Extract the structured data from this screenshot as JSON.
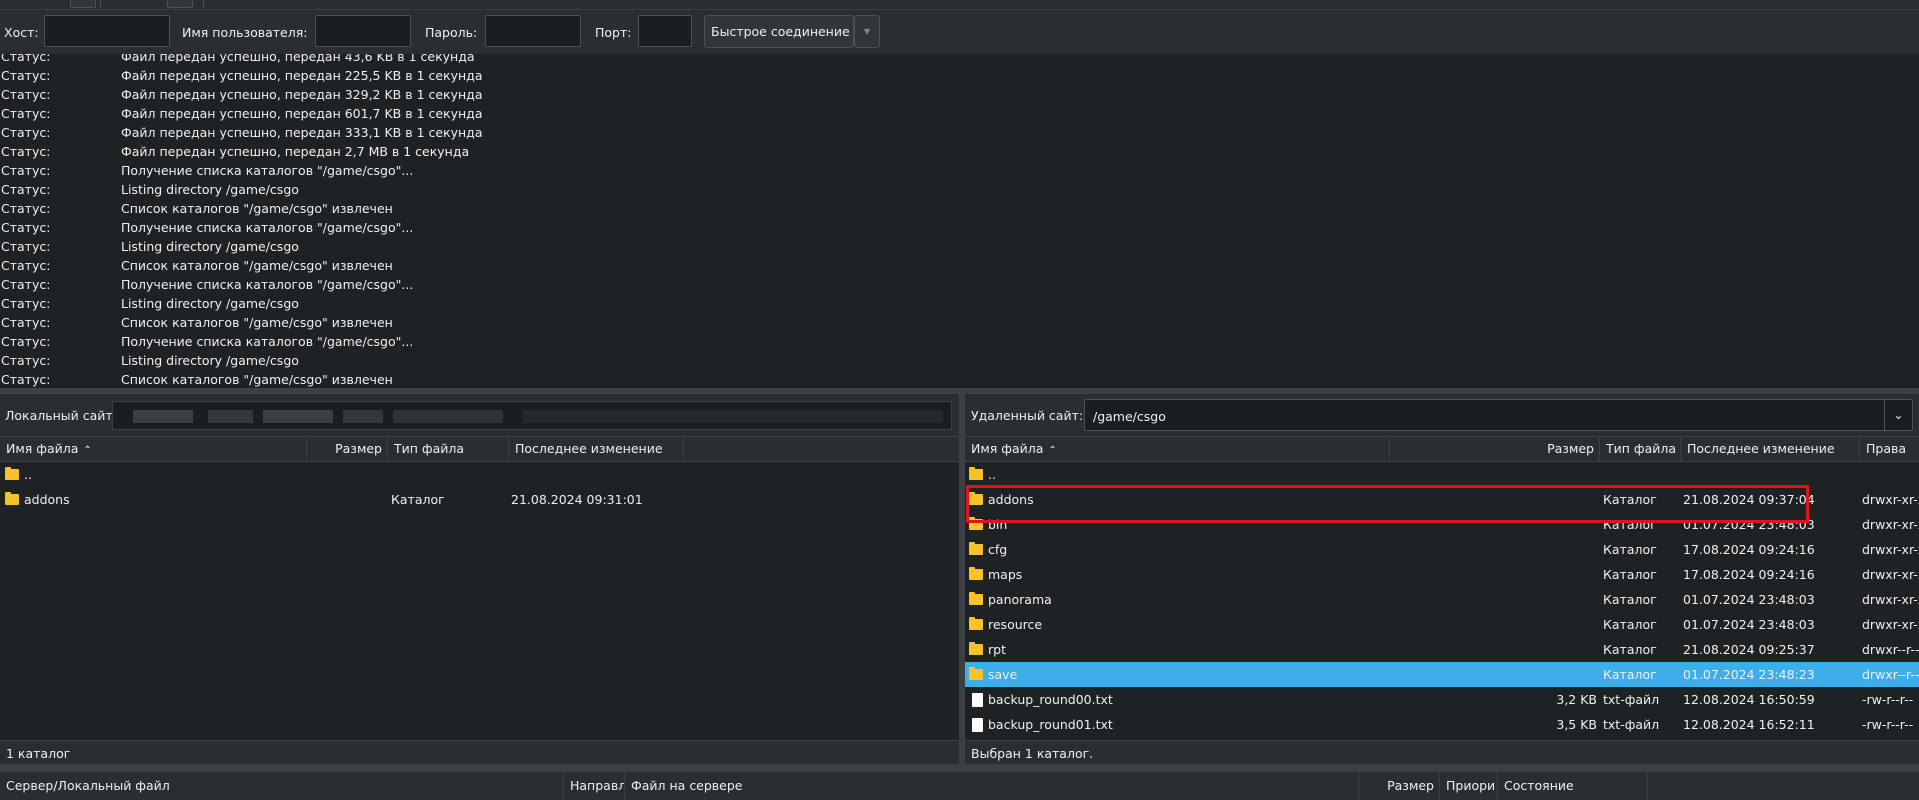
{
  "quickconnect": {
    "host_label": "Хост:",
    "user_label": "Имя пользователя:",
    "pass_label": "Пароль:",
    "port_label": "Порт:",
    "connect_button": "Быстрое соединение",
    "host_value": "",
    "user_value": "",
    "pass_value": "",
    "port_value": ""
  },
  "log": [
    {
      "k": "Статус:",
      "v": "Файл передан успешно, передан 43,6 KB в 1 секунда"
    },
    {
      "k": "Статус:",
      "v": "Файл передан успешно, передан 225,5 KB в 1 секунда"
    },
    {
      "k": "Статус:",
      "v": "Файл передан успешно, передан 329,2 KB в 1 секунда"
    },
    {
      "k": "Статус:",
      "v": "Файл передан успешно, передан 601,7 KB в 1 секунда"
    },
    {
      "k": "Статус:",
      "v": "Файл передан успешно, передан 333,1 KB в 1 секунда"
    },
    {
      "k": "Статус:",
      "v": "Файл передан успешно, передан 2,7 MB в 1 секунда"
    },
    {
      "k": "Статус:",
      "v": "Получение списка каталогов \"/game/csgo\"..."
    },
    {
      "k": "Статус:",
      "v": "Listing directory /game/csgo"
    },
    {
      "k": "Статус:",
      "v": "Список каталогов \"/game/csgo\" извлечен"
    },
    {
      "k": "Статус:",
      "v": "Получение списка каталогов \"/game/csgo\"..."
    },
    {
      "k": "Статус:",
      "v": "Listing directory /game/csgo"
    },
    {
      "k": "Статус:",
      "v": "Список каталогов \"/game/csgo\" извлечен"
    },
    {
      "k": "Статус:",
      "v": "Получение списка каталогов \"/game/csgo\"..."
    },
    {
      "k": "Статус:",
      "v": "Listing directory /game/csgo"
    },
    {
      "k": "Статус:",
      "v": "Список каталогов \"/game/csgo\" извлечен"
    },
    {
      "k": "Статус:",
      "v": "Получение списка каталогов \"/game/csgo\"..."
    },
    {
      "k": "Статус:",
      "v": "Listing directory /game/csgo"
    },
    {
      "k": "Статус:",
      "v": "Список каталогов \"/game/csgo\" извлечен"
    }
  ],
  "local": {
    "site_label": "Локальный сайт:",
    "columns": {
      "name": "Имя файла",
      "size": "Размер",
      "type": "Тип файла",
      "modified": "Последнее изменение"
    },
    "files": [
      {
        "name": "..",
        "size": "",
        "type": "",
        "modified": "",
        "icon": "folder"
      },
      {
        "name": "addons",
        "size": "",
        "type": "Каталог",
        "modified": "21.08.2024 09:31:01",
        "icon": "folder"
      }
    ],
    "status": "1 каталог"
  },
  "remote": {
    "site_label": "Удаленный сайт:",
    "path": "/game/csgo",
    "columns": {
      "name": "Имя файла",
      "size": "Размер",
      "type": "Тип файла",
      "modified": "Последнее изменение",
      "perms": "Права"
    },
    "files": [
      {
        "name": "..",
        "size": "",
        "type": "",
        "modified": "",
        "perms": "",
        "icon": "folder"
      },
      {
        "name": "addons",
        "size": "",
        "type": "Каталог",
        "modified": "21.08.2024 09:37:04",
        "perms": "drwxr-xr-x",
        "icon": "folder"
      },
      {
        "name": "bin",
        "size": "",
        "type": "Каталог",
        "modified": "01.07.2024 23:48:03",
        "perms": "drwxr-xr-x",
        "icon": "folder"
      },
      {
        "name": "cfg",
        "size": "",
        "type": "Каталог",
        "modified": "17.08.2024 09:24:16",
        "perms": "drwxr-xr-x",
        "icon": "folder"
      },
      {
        "name": "maps",
        "size": "",
        "type": "Каталог",
        "modified": "17.08.2024 09:24:16",
        "perms": "drwxr-xr-x",
        "icon": "folder"
      },
      {
        "name": "panorama",
        "size": "",
        "type": "Каталог",
        "modified": "01.07.2024 23:48:03",
        "perms": "drwxr-xr-x",
        "icon": "folder"
      },
      {
        "name": "resource",
        "size": "",
        "type": "Каталог",
        "modified": "01.07.2024 23:48:03",
        "perms": "drwxr-xr-x",
        "icon": "folder"
      },
      {
        "name": "rpt",
        "size": "",
        "type": "Каталог",
        "modified": "21.08.2024 09:25:37",
        "perms": "drwxr--r--",
        "icon": "folder"
      },
      {
        "name": "save",
        "size": "",
        "type": "Каталог",
        "modified": "01.07.2024 23:48:23",
        "perms": "drwxr--r--",
        "icon": "folder",
        "selected": true
      },
      {
        "name": "backup_round00.txt",
        "size": "3,2 KB",
        "type": "txt-файл",
        "modified": "12.08.2024 16:50:59",
        "perms": "-rw-r--r--",
        "icon": "file"
      },
      {
        "name": "backup_round01.txt",
        "size": "3,5 KB",
        "type": "txt-файл",
        "modified": "12.08.2024 16:52:11",
        "perms": "-rw-r--r--",
        "icon": "file"
      }
    ],
    "status": "Выбран 1 каталог."
  },
  "queue": {
    "columns": [
      "Сервер/Локальный файл",
      "Направл",
      "Файл на сервере",
      "Размер",
      "Приори",
      "Состояние"
    ]
  }
}
